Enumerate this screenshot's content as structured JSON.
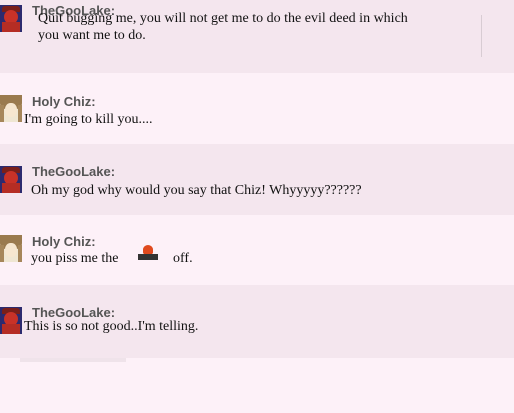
{
  "messages": [
    {
      "user": "TheGooLake:",
      "lines": [
        "Quit bugging me, you will not get me to do the evil deed in which",
        "you want me to do."
      ]
    },
    {
      "user": "Holy Chiz:",
      "lines": [
        "I'm going to kill you...."
      ]
    },
    {
      "user": "TheGooLake:",
      "lines": [
        "Oh my god why would you say that Chiz! Whyyyyy??????"
      ]
    },
    {
      "user": "Holy Chiz:",
      "before": "you piss me the",
      "emote": "bomb-emoticon-icon",
      "after": "off."
    },
    {
      "user": "TheGooLake:",
      "lines": [
        "This is so not good..I'm telling."
      ]
    }
  ]
}
